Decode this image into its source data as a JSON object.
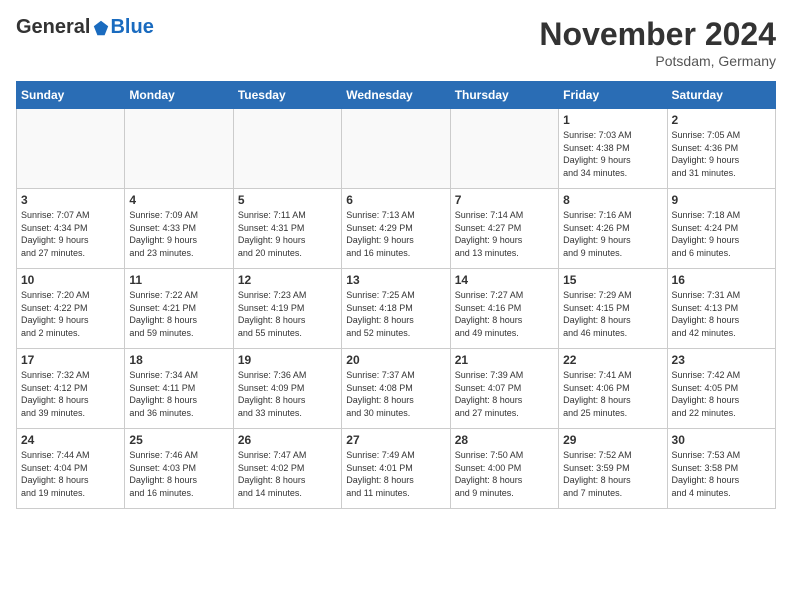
{
  "header": {
    "logo_general": "General",
    "logo_blue": "Blue",
    "month_title": "November 2024",
    "location": "Potsdam, Germany"
  },
  "days_of_week": [
    "Sunday",
    "Monday",
    "Tuesday",
    "Wednesday",
    "Thursday",
    "Friday",
    "Saturday"
  ],
  "weeks": [
    [
      {
        "day": "",
        "info": ""
      },
      {
        "day": "",
        "info": ""
      },
      {
        "day": "",
        "info": ""
      },
      {
        "day": "",
        "info": ""
      },
      {
        "day": "",
        "info": ""
      },
      {
        "day": "1",
        "info": "Sunrise: 7:03 AM\nSunset: 4:38 PM\nDaylight: 9 hours\nand 34 minutes."
      },
      {
        "day": "2",
        "info": "Sunrise: 7:05 AM\nSunset: 4:36 PM\nDaylight: 9 hours\nand 31 minutes."
      }
    ],
    [
      {
        "day": "3",
        "info": "Sunrise: 7:07 AM\nSunset: 4:34 PM\nDaylight: 9 hours\nand 27 minutes."
      },
      {
        "day": "4",
        "info": "Sunrise: 7:09 AM\nSunset: 4:33 PM\nDaylight: 9 hours\nand 23 minutes."
      },
      {
        "day": "5",
        "info": "Sunrise: 7:11 AM\nSunset: 4:31 PM\nDaylight: 9 hours\nand 20 minutes."
      },
      {
        "day": "6",
        "info": "Sunrise: 7:13 AM\nSunset: 4:29 PM\nDaylight: 9 hours\nand 16 minutes."
      },
      {
        "day": "7",
        "info": "Sunrise: 7:14 AM\nSunset: 4:27 PM\nDaylight: 9 hours\nand 13 minutes."
      },
      {
        "day": "8",
        "info": "Sunrise: 7:16 AM\nSunset: 4:26 PM\nDaylight: 9 hours\nand 9 minutes."
      },
      {
        "day": "9",
        "info": "Sunrise: 7:18 AM\nSunset: 4:24 PM\nDaylight: 9 hours\nand 6 minutes."
      }
    ],
    [
      {
        "day": "10",
        "info": "Sunrise: 7:20 AM\nSunset: 4:22 PM\nDaylight: 9 hours\nand 2 minutes."
      },
      {
        "day": "11",
        "info": "Sunrise: 7:22 AM\nSunset: 4:21 PM\nDaylight: 8 hours\nand 59 minutes."
      },
      {
        "day": "12",
        "info": "Sunrise: 7:23 AM\nSunset: 4:19 PM\nDaylight: 8 hours\nand 55 minutes."
      },
      {
        "day": "13",
        "info": "Sunrise: 7:25 AM\nSunset: 4:18 PM\nDaylight: 8 hours\nand 52 minutes."
      },
      {
        "day": "14",
        "info": "Sunrise: 7:27 AM\nSunset: 4:16 PM\nDaylight: 8 hours\nand 49 minutes."
      },
      {
        "day": "15",
        "info": "Sunrise: 7:29 AM\nSunset: 4:15 PM\nDaylight: 8 hours\nand 46 minutes."
      },
      {
        "day": "16",
        "info": "Sunrise: 7:31 AM\nSunset: 4:13 PM\nDaylight: 8 hours\nand 42 minutes."
      }
    ],
    [
      {
        "day": "17",
        "info": "Sunrise: 7:32 AM\nSunset: 4:12 PM\nDaylight: 8 hours\nand 39 minutes."
      },
      {
        "day": "18",
        "info": "Sunrise: 7:34 AM\nSunset: 4:11 PM\nDaylight: 8 hours\nand 36 minutes."
      },
      {
        "day": "19",
        "info": "Sunrise: 7:36 AM\nSunset: 4:09 PM\nDaylight: 8 hours\nand 33 minutes."
      },
      {
        "day": "20",
        "info": "Sunrise: 7:37 AM\nSunset: 4:08 PM\nDaylight: 8 hours\nand 30 minutes."
      },
      {
        "day": "21",
        "info": "Sunrise: 7:39 AM\nSunset: 4:07 PM\nDaylight: 8 hours\nand 27 minutes."
      },
      {
        "day": "22",
        "info": "Sunrise: 7:41 AM\nSunset: 4:06 PM\nDaylight: 8 hours\nand 25 minutes."
      },
      {
        "day": "23",
        "info": "Sunrise: 7:42 AM\nSunset: 4:05 PM\nDaylight: 8 hours\nand 22 minutes."
      }
    ],
    [
      {
        "day": "24",
        "info": "Sunrise: 7:44 AM\nSunset: 4:04 PM\nDaylight: 8 hours\nand 19 minutes."
      },
      {
        "day": "25",
        "info": "Sunrise: 7:46 AM\nSunset: 4:03 PM\nDaylight: 8 hours\nand 16 minutes."
      },
      {
        "day": "26",
        "info": "Sunrise: 7:47 AM\nSunset: 4:02 PM\nDaylight: 8 hours\nand 14 minutes."
      },
      {
        "day": "27",
        "info": "Sunrise: 7:49 AM\nSunset: 4:01 PM\nDaylight: 8 hours\nand 11 minutes."
      },
      {
        "day": "28",
        "info": "Sunrise: 7:50 AM\nSunset: 4:00 PM\nDaylight: 8 hours\nand 9 minutes."
      },
      {
        "day": "29",
        "info": "Sunrise: 7:52 AM\nSunset: 3:59 PM\nDaylight: 8 hours\nand 7 minutes."
      },
      {
        "day": "30",
        "info": "Sunrise: 7:53 AM\nSunset: 3:58 PM\nDaylight: 8 hours\nand 4 minutes."
      }
    ]
  ]
}
